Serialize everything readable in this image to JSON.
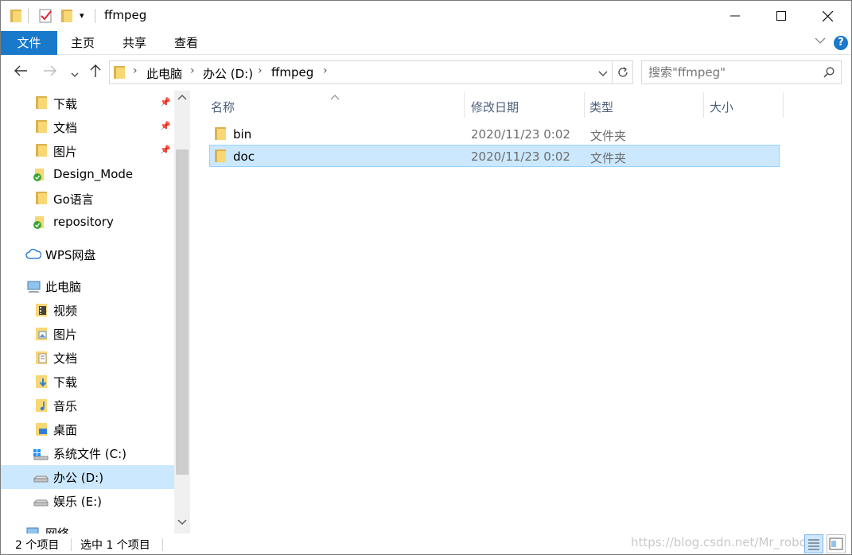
{
  "window": {
    "title": "ffmpeg"
  },
  "ribbon": {
    "tabs": [
      "文件",
      "主页",
      "共享",
      "查看"
    ],
    "help": "?"
  },
  "address": {
    "crumbs": [
      "此电脑",
      "办公 (D:)",
      "ffmpeg"
    ]
  },
  "search": {
    "placeholder": "搜索\"ffmpeg\""
  },
  "nav_pane": {
    "items": [
      {
        "label": "下载",
        "icon": "download-folder-icon",
        "pinned": true
      },
      {
        "label": "文档",
        "icon": "documents-folder-icon",
        "pinned": true
      },
      {
        "label": "图片",
        "icon": "pictures-folder-icon",
        "pinned": true
      },
      {
        "label": "Design_Mode",
        "icon": "synced-folder-icon"
      },
      {
        "label": "Go语言",
        "icon": "folder-icon"
      },
      {
        "label": "repository",
        "icon": "synced-folder-icon"
      },
      {
        "label": "WPS网盘",
        "icon": "cloud-icon"
      },
      {
        "label": "此电脑",
        "icon": "computer-icon"
      },
      {
        "label": "视频",
        "icon": "videos-folder-icon"
      },
      {
        "label": "图片",
        "icon": "pictures-folder-icon"
      },
      {
        "label": "文档",
        "icon": "documents-folder-icon"
      },
      {
        "label": "下载",
        "icon": "download-folder-icon"
      },
      {
        "label": "音乐",
        "icon": "music-folder-icon"
      },
      {
        "label": "桌面",
        "icon": "desktop-folder-icon"
      },
      {
        "label": "系统文件 (C:)",
        "icon": "windows-drive-icon"
      },
      {
        "label": "办公 (D:)",
        "icon": "drive-icon",
        "selected": true
      },
      {
        "label": "娱乐 (E:)",
        "icon": "drive-icon"
      },
      {
        "label": "网络",
        "icon": "network-icon"
      }
    ]
  },
  "file_list": {
    "columns": [
      "名称",
      "修改日期",
      "类型",
      "大小"
    ],
    "rows": [
      {
        "name": "bin",
        "date": "2020/11/23 0:02",
        "type": "文件夹",
        "size": ""
      },
      {
        "name": "doc",
        "date": "2020/11/23 0:02",
        "type": "文件夹",
        "size": "",
        "selected": true
      }
    ]
  },
  "status_bar": {
    "item_count": "2 个项目",
    "selection": "选中 1 个项目",
    "watermark": "https://blog.csdn.net/Mr_robot_"
  },
  "colors": {
    "accent": "#1979ca",
    "selection": "#cce8ff",
    "folder": "#f8d775"
  }
}
